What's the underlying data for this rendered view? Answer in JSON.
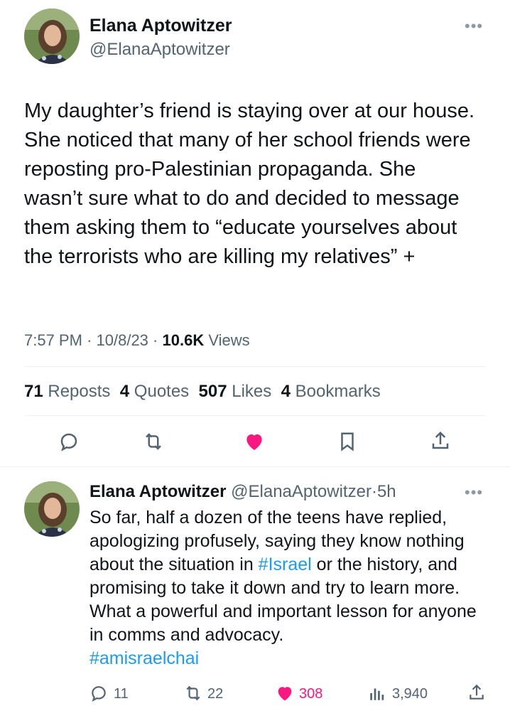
{
  "colors": {
    "accent": "#1d9bf0",
    "like": "#f91880",
    "secondary": "#536471",
    "text": "#0f1419"
  },
  "tweet": {
    "author_name": "Elana Aptowitzer",
    "author_handle": "@ElanaAptowitzer",
    "more_icon": "more-dots-icon",
    "text": "My daughter’s friend is staying over at our house. She noticed that many of her school friends were reposting pro-Palestinian propaganda. She wasn’t sure what to do and decided to message them asking them to “educate yourselves about the terrorists who are killing my relatives” +",
    "time": "7:57 PM",
    "sep1": "·",
    "date": "10/8/23",
    "sep2": "·",
    "views_count": "10.6K",
    "views_label": "Views",
    "stats": {
      "reposts_count": "71",
      "reposts_label": "Reposts",
      "quotes_count": "4",
      "quotes_label": "Quotes",
      "likes_count": "507",
      "likes_label": "Likes",
      "bookmarks_count": "4",
      "bookmarks_label": "Bookmarks"
    },
    "actions": [
      "reply-icon",
      "repost-icon",
      "like-icon-filled",
      "bookmark-icon",
      "share-icon"
    ]
  },
  "reply": {
    "author_name": "Elana Aptowitzer",
    "author_handle": "@ElanaAptowitzer",
    "sep": "·",
    "age": "5h",
    "text_before": "So far, half a dozen of the teens have replied, apologizing profusely, saying they know nothing about the situation in ",
    "hashtag1": "#Israel",
    "text_after": " or the history, and promising to take it down and try to learn more. What a powerful and important lesson for anyone in comms and advocacy.",
    "hashtag2": "#amisraelchai",
    "counts": {
      "replies": "11",
      "reposts": "22",
      "likes": "308",
      "views": "3,940"
    }
  }
}
